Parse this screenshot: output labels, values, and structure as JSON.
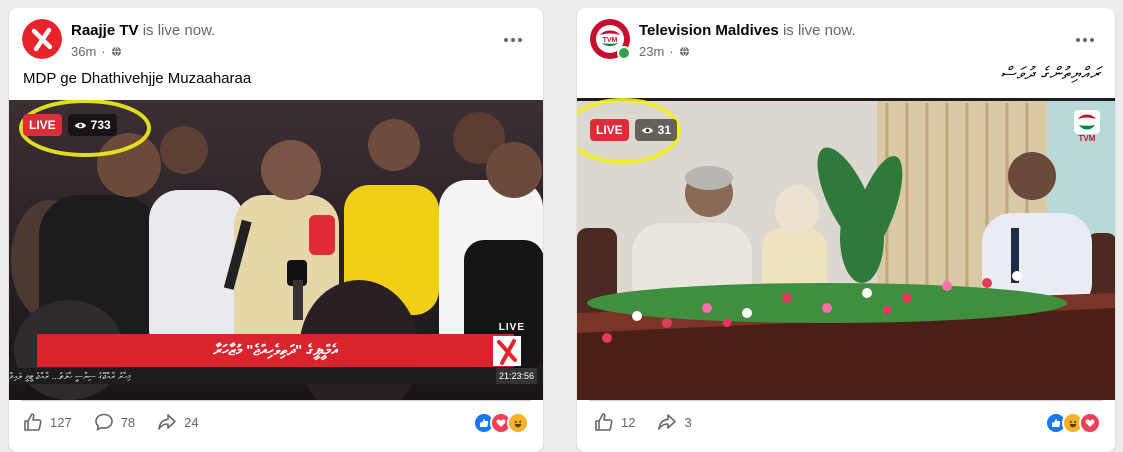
{
  "posts": [
    {
      "page_name": "Raajje TV",
      "live_text": "is live now.",
      "time": "36m",
      "caption": "MDP ge Dhathivehjje Muzaaharaa",
      "live_label": "LIVE",
      "viewers": "733",
      "overlay": {
        "headline": "އެމްޑީޕީގެ \"ދަތިވެހިއްޖެ\" މުޒާހަރާ",
        "ticker": "މިހާރު ރާއްޖޭގެ ސިޔާސީ ހާލަތު... ރާއްޖެ ޓީވީ ލައިވް",
        "clock": "21:23:56",
        "live_word": "LIVE"
      },
      "actions": {
        "likes": "127",
        "comments": "78",
        "shares": "24"
      },
      "reactions": [
        "like",
        "love",
        "haha"
      ]
    },
    {
      "page_name": "Television Maldives",
      "live_text": "is live now.",
      "time": "23m",
      "caption": "ރައްޔިތުންގެ ދުވަސް",
      "live_label": "LIVE",
      "viewers": "31",
      "watermark": "TVM",
      "actions": {
        "likes": "12",
        "shares": "3"
      },
      "reactions": [
        "like",
        "haha",
        "love"
      ]
    }
  ],
  "colors": {
    "live_red": "#e02b38",
    "highlight": "#f3f01e",
    "raajje_red": "#e8232c",
    "tvm_red": "#c8102e",
    "like_blue": "#1877f2",
    "love_red": "#f33e58",
    "haha_yellow": "#f7b125"
  }
}
